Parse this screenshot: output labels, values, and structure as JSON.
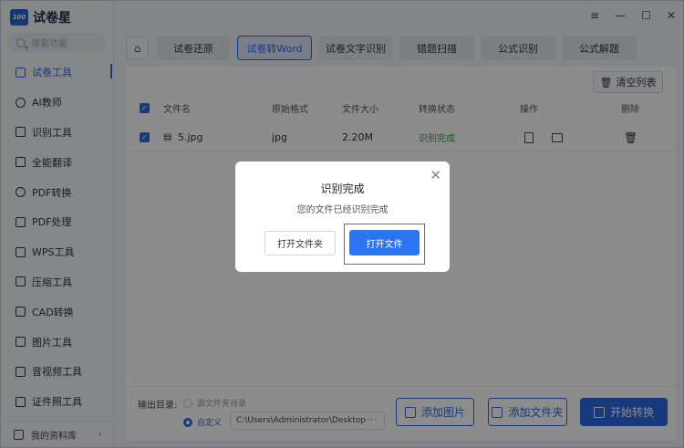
{
  "app": {
    "logo_badge": "100",
    "title": "试卷星",
    "search_placeholder": "搜索功能"
  },
  "sidebar": {
    "items": [
      {
        "label": "试卷工具",
        "icon": "layers-icon",
        "active": true
      },
      {
        "label": "AI教师",
        "icon": "teacher-icon"
      },
      {
        "label": "识别工具",
        "icon": "scan-icon"
      },
      {
        "label": "全能翻译",
        "icon": "translate-icon"
      },
      {
        "label": "PDF转换",
        "icon": "pdf-convert-icon"
      },
      {
        "label": "PDF处理",
        "icon": "pdf-process-icon"
      },
      {
        "label": "WPS工具",
        "icon": "wps-icon"
      },
      {
        "label": "压缩工具",
        "icon": "compress-icon"
      },
      {
        "label": "CAD转换",
        "icon": "cad-icon"
      },
      {
        "label": "图片工具",
        "icon": "image-icon"
      },
      {
        "label": "音视频工具",
        "icon": "media-icon"
      },
      {
        "label": "证件照工具",
        "icon": "id-photo-icon"
      }
    ],
    "bottom_label": "我的资料库"
  },
  "window_controls": {
    "menu": "≡",
    "minimize": "—",
    "maximize": "☐",
    "close": "✕"
  },
  "tabs": [
    {
      "label": "试卷还原"
    },
    {
      "label": "试卷转Word",
      "active": true
    },
    {
      "label": "试卷文字识别"
    },
    {
      "label": "错题扫描"
    },
    {
      "label": "公式识别"
    },
    {
      "label": "公式解题"
    }
  ],
  "toolbar": {
    "clear_label": "清空列表"
  },
  "table": {
    "headers": [
      "文件名",
      "原始格式",
      "文件大小",
      "转换状态",
      "操作",
      "删除"
    ],
    "rows": [
      {
        "name": "5.jpg",
        "format": "jpg",
        "size": "2.20M",
        "status": "识别完成"
      }
    ]
  },
  "footer": {
    "output_label": "输出目录:",
    "option_source": "源文件夹目录",
    "option_custom": "自定义",
    "path": "C:\\Users\\Administrator\\Desktop",
    "path_more": "···",
    "add_image": "添加图片",
    "add_folder": "添加文件夹",
    "start": "开始转换"
  },
  "modal": {
    "title": "识别完成",
    "message": "您的文件已经识别完成",
    "open_folder": "打开文件夹",
    "open_file": "打开文件"
  },
  "colors": {
    "accent": "#2d6ae3",
    "success": "#2fa44f",
    "highlight": "#e23b3b"
  }
}
